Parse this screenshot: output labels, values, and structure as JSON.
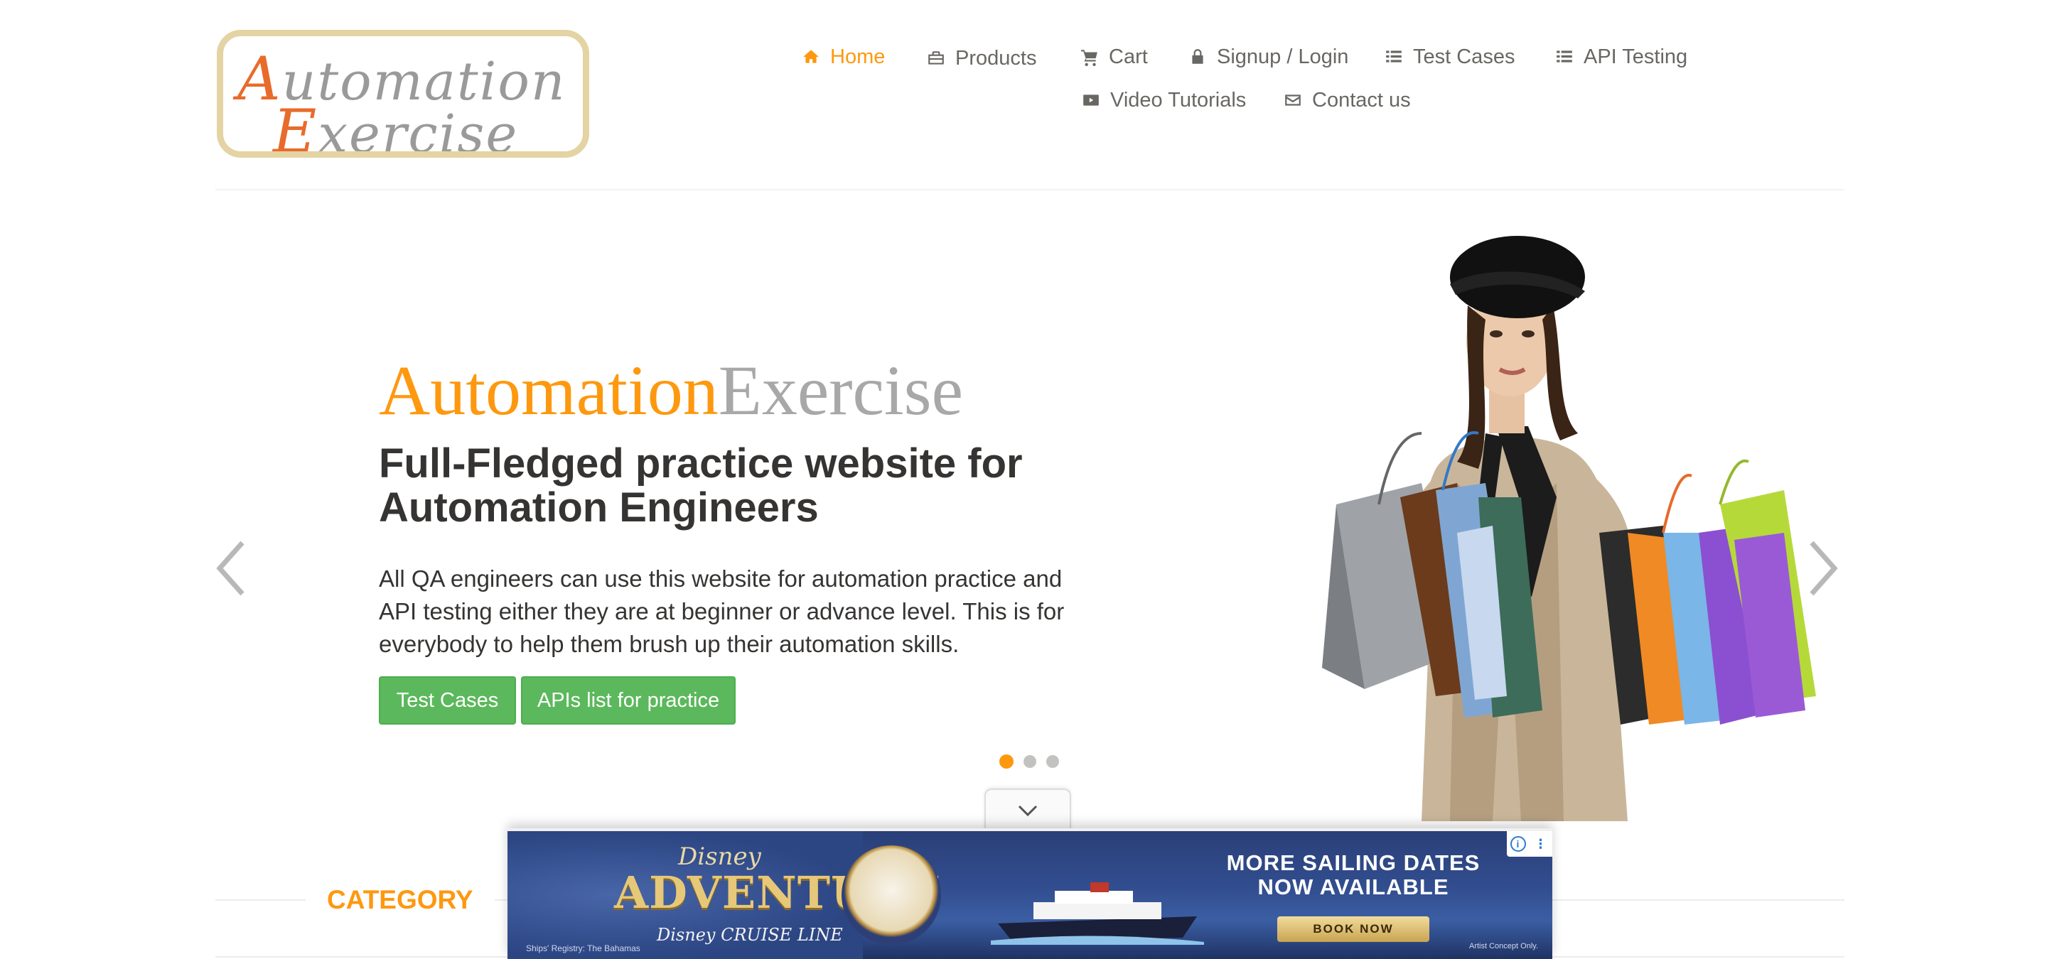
{
  "logo": {
    "line1_cap": "A",
    "line1_rest": "utomation",
    "line2_cap": "E",
    "line2_rest": "xercise"
  },
  "nav": {
    "items": [
      {
        "label": "Home",
        "icon": "home-icon",
        "active": true
      },
      {
        "label": "Products",
        "icon": "briefcase-icon"
      },
      {
        "label": "Cart",
        "icon": "cart-icon"
      },
      {
        "label": "Signup / Login",
        "icon": "lock-icon"
      },
      {
        "label": "Test Cases",
        "icon": "list-icon"
      },
      {
        "label": "API Testing",
        "icon": "list-icon"
      },
      {
        "label": "Video Tutorials",
        "icon": "youtube-play-icon"
      },
      {
        "label": "Contact us",
        "icon": "envelope-icon"
      }
    ]
  },
  "slider": {
    "brand_part1": "Automation",
    "brand_part2": "Exercise",
    "headline": "Full-Fledged practice website for Automation Engineers",
    "lead": "All QA engineers can use this website for automation practice and API testing either they are at beginner or advance level. This is for everybody to help them brush up their automation skills.",
    "buttons": {
      "test_cases": "Test Cases",
      "apis_list": "APIs list for practice"
    },
    "indicators": {
      "count": 3,
      "active": 1
    },
    "prev_icon": "chevron-left-icon",
    "next_icon": "chevron-right-icon"
  },
  "category": {
    "title": "Category"
  },
  "ad": {
    "brand": "Disney",
    "title": "ADVENTURE",
    "subtitle": "Disney CRUISE LINE",
    "registry": "Ships' Registry: The Bahamas",
    "headline": "MORE SAILING DATES NOW AVAILABLE",
    "cta": "BOOK NOW",
    "disclaimer": "Artist Concept Only.",
    "toggle_icon": "chevron-down-icon"
  },
  "colors": {
    "accent": "#fe980f",
    "text": "#696763",
    "heading": "#363432",
    "button_green": "#5cb85c",
    "indicator_inactive": "#c2c2c1"
  }
}
